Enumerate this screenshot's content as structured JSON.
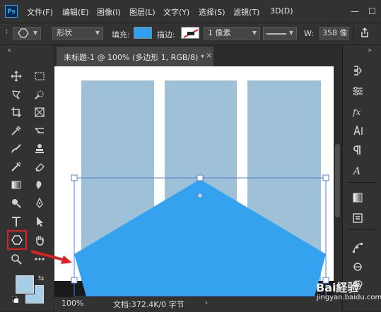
{
  "app": {
    "logo_text": "Ps"
  },
  "menu": [
    "文件(F)",
    "编辑(E)",
    "图像(I)",
    "图层(L)",
    "文字(Y)",
    "选择(S)",
    "滤镜(T)",
    "3D(D)"
  ],
  "window_controls": {
    "minimize": "—",
    "maximize": "☐"
  },
  "options_bar": {
    "mode": "形状",
    "fill_label": "填充:",
    "fill_color": "#31a0ef",
    "stroke_label": "描边:",
    "stroke_width": "1 像素",
    "width_label": "W:",
    "width_value": "358 像"
  },
  "document": {
    "tab_title": "未标题-1 @ 100% (多边形 1, RGB/8) *",
    "close": "×",
    "zoom": "100%",
    "info": "文档:372.4K/0 字节",
    "shape_color": "#34a2ee",
    "column_color": "#9fc1d8"
  },
  "colors": {
    "foreground": "#a8cde6",
    "background": "#a8cde6",
    "highlight": "#e02020"
  },
  "right_panel": {
    "items": [
      "history-icon",
      "adjustments-icon",
      "fx-icon",
      "character-icon",
      "paragraph-icon",
      "glyphs-icon",
      "gradient-icon",
      "libraries-icon",
      "properties-icon",
      "paths-icon",
      "channels-icon"
    ]
  },
  "watermark": {
    "brand": "Bai経验",
    "url": "jingyan.baidu.com"
  }
}
